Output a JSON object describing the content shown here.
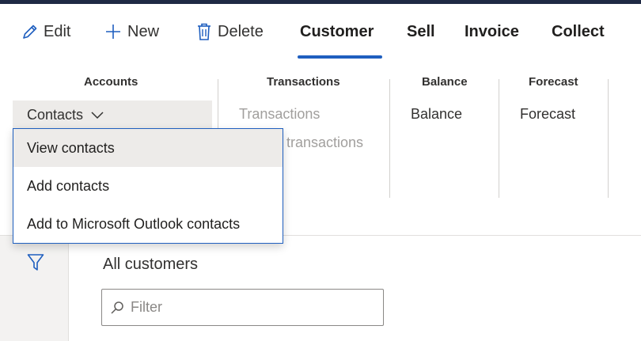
{
  "actions": {
    "edit": "Edit",
    "new": "New",
    "delete": "Delete"
  },
  "tabs": [
    "Customer",
    "Sell",
    "Invoice",
    "Collect"
  ],
  "selected_tab": "Customer",
  "ribbon": {
    "groups": {
      "accounts": {
        "title": "Accounts",
        "button": "Contacts"
      },
      "transactions": {
        "title": "Transactions",
        "items": [
          "Transactions",
          "transactions"
        ]
      },
      "balance": {
        "title": "Balance",
        "items": [
          "Balance"
        ]
      },
      "forecast": {
        "title": "Forecast",
        "items": [
          "Forecast"
        ]
      }
    }
  },
  "contacts_menu": {
    "items": [
      "View contacts",
      "Add contacts",
      "Add to Microsoft Outlook contacts"
    ],
    "highlighted": "View contacts"
  },
  "list": {
    "title": "All customers",
    "filter_placeholder": "Filter"
  },
  "colors": {
    "accent": "#1f5fbf",
    "topbar": "#1f2a44",
    "hover": "#edebe9"
  }
}
